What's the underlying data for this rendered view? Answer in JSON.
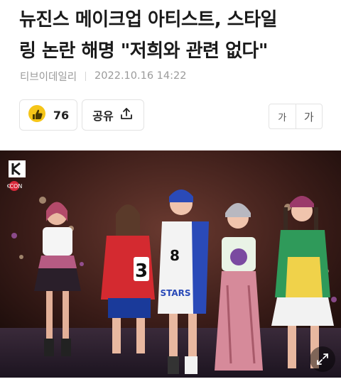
{
  "article": {
    "title_line1": "뉴진스 메이크업 아티스트, 스타일",
    "title_line2": "링 논란 해명 \"저희와 관련 없다\"",
    "publisher": "티브이데일리",
    "datetime": "2022.10.16 14:22"
  },
  "actions": {
    "reaction_icon": "thumbs-up-emoji-icon",
    "reaction_count": "76",
    "share_label": "공유",
    "share_icon": "share-upload-icon"
  },
  "font_size": {
    "small_label": "가",
    "large_label": "가"
  },
  "photo": {
    "subject": "five performers on stage in colorful stage outfits",
    "jersey_numbers": [
      "3",
      "8"
    ],
    "jersey_text": "STARS",
    "watermark": "KCON",
    "expand_icon": "expand-arrows-icon"
  },
  "colors": {
    "title": "#1a1a1a",
    "meta": "#9a9a9a",
    "border": "#e3e3e3",
    "reaction_emoji": "#f5c518"
  }
}
